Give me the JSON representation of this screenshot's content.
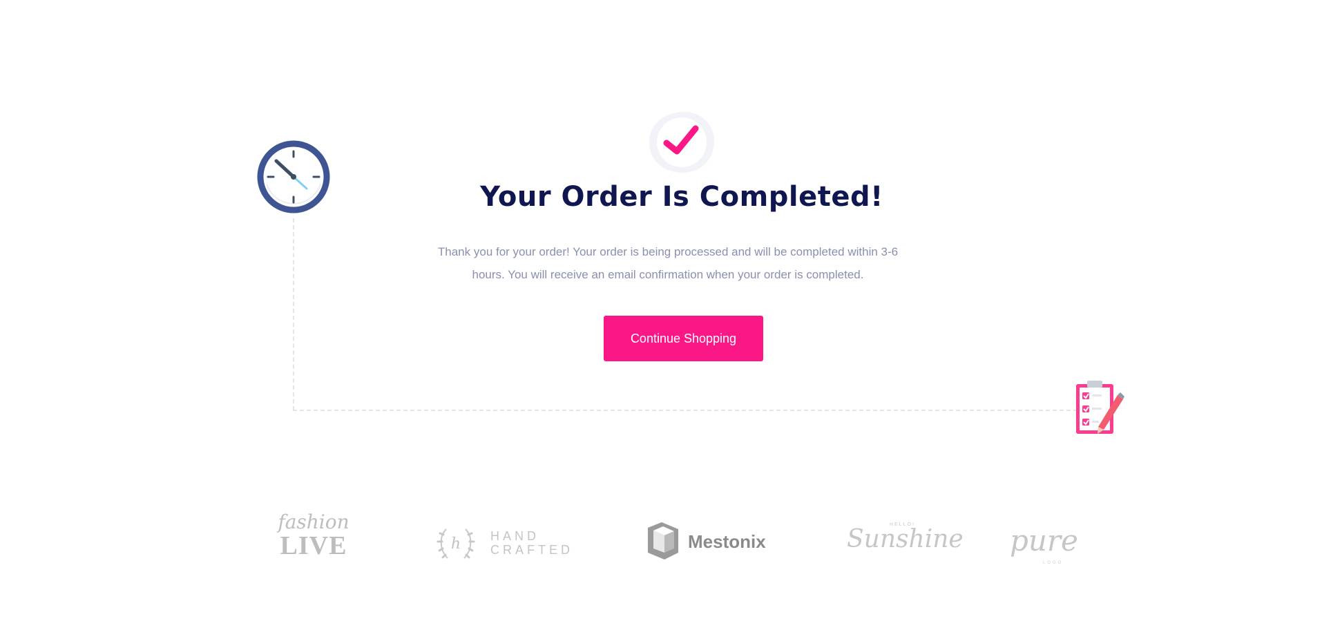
{
  "order_complete": {
    "title": "Your Order Is Completed!",
    "message": "Thank you for your order! Your order is being processed and will be completed within 3-6 hours. You will receive an email confirmation when your order is completed.",
    "continue_label": "Continue Shopping"
  },
  "brands": {
    "fashion_script": "fashion",
    "fashion_bold": "LIVE",
    "hand_mark": "h",
    "hand_line1": "HAND",
    "hand_line2": "CRAFTED",
    "mestonix": "Mestonix",
    "sunshine_small": "HELLO!",
    "sunshine": "Sunshine",
    "pure": "pure",
    "pure_small": "LOGO"
  },
  "colors": {
    "accent": "#fb1786",
    "title": "#101750",
    "text": "#8a8fb0",
    "clock_ring": "#3f5593"
  },
  "icons": {
    "success": "checkmark-icon",
    "time": "clock-icon",
    "checklist": "clipboard-checklist-icon"
  }
}
